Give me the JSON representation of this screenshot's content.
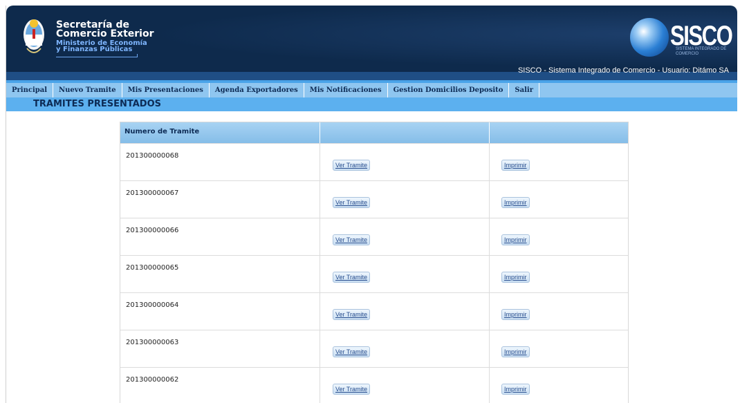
{
  "header": {
    "secretaria": [
      "Secretaría de",
      "Comercio Exterior"
    ],
    "ministerio": [
      "Ministerio de Economía",
      "y Finanzas Públicas"
    ],
    "logo_text": "SISCO",
    "logo_subtitle": "SISTEMA INTEGRADO DE COMERCIO",
    "info": "SISCO - Sistema Integrado de Comercio - Usuario: Ditámo SA"
  },
  "nav": {
    "items": [
      "Principal",
      "Nuevo Tramite",
      "Mis Presentaciones",
      "Agenda Exportadores",
      "Mis Notificaciones",
      "Gestion Domicilios Deposito",
      "Salir"
    ]
  },
  "page": {
    "title": "TRAMITES PRESENTADOS"
  },
  "table": {
    "headers": [
      "Numero de Tramite",
      "",
      ""
    ],
    "view_label": "Ver Tramite",
    "print_label": "Imprimir",
    "rows": [
      "201300000068",
      "201300000067",
      "201300000066",
      "201300000065",
      "201300000064",
      "201300000063",
      "201300000062"
    ]
  },
  "colors": {
    "header_bg": "#0e2a4c",
    "nav_bg": "#8fc6f0",
    "title_bar": "#5cb0ef",
    "table_header": "#8ec3ea"
  }
}
